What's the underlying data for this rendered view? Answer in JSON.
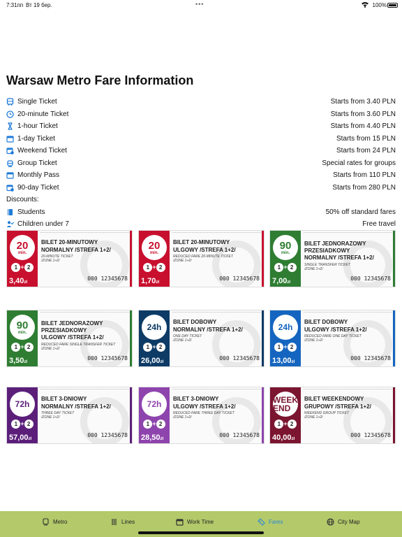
{
  "status": {
    "time": "7:31пп",
    "date": "Вт 19 бер.",
    "dots": "•••",
    "battery": "100%"
  },
  "page_title": "Warsaw Metro Fare Information",
  "fares": [
    {
      "name": "Single Ticket",
      "price": "Starts from 3.40 PLN",
      "icon": "bus-icon"
    },
    {
      "name": "20-minute Ticket",
      "price": "Starts from 3.60 PLN",
      "icon": "clock-icon"
    },
    {
      "name": "1-hour Ticket",
      "price": "Starts from 4.40 PLN",
      "icon": "hourglass-icon"
    },
    {
      "name": "1-day Ticket",
      "price": "Starts from 15 PLN",
      "icon": "calendar-icon"
    },
    {
      "name": "Weekend Ticket",
      "price": "Starts from 24 PLN",
      "icon": "calendar-clock-icon"
    },
    {
      "name": "Group Ticket",
      "price": "Special rates for groups",
      "icon": "tram-icon"
    },
    {
      "name": "Monthly Pass",
      "price": "Starts from 110 PLN",
      "icon": "calendar-icon"
    },
    {
      "name": "90-day Ticket",
      "price": "Starts from 280 PLN",
      "icon": "calendar-clock-icon"
    }
  ],
  "discounts_heading": "Discounts:",
  "discounts": [
    {
      "name": "Students",
      "value": "50% off standard fares",
      "icon": "book-icon"
    },
    {
      "name": "Children under 7",
      "value": "Free travel",
      "icon": "person-check-icon"
    }
  ],
  "tickets": [
    {
      "color": "#c8102e",
      "badge_num": "20",
      "badge_unit": "min.",
      "zones": [
        "1",
        "2"
      ],
      "price": "3,40",
      "currency": "zł",
      "title1": "BILET 20-MINUTOWY",
      "title2": "NORMALNY /STREFA 1+2/",
      "title3": "",
      "sub1": "20-MINUTE TICKET",
      "sub2": "/ZONE 1+2/",
      "serial": "000 12345678",
      "stripe": "#c8102e"
    },
    {
      "color": "#c8102e",
      "badge_num": "20",
      "badge_unit": "min.",
      "zones": [
        "1",
        "2"
      ],
      "price": "1,70",
      "currency": "zł",
      "title1": "BILET 20-MINUTOWY",
      "title2": "ULGOWY /STREFA 1+2/",
      "title3": "",
      "sub1": "REDUCED FARE 20-MINUTE TICKET",
      "sub2": "/ZONE 1+2/",
      "serial": "000 12345678",
      "stripe": "#c8102e"
    },
    {
      "color": "#2e7d32",
      "badge_num": "90",
      "badge_unit": "min.",
      "zones": [
        "1",
        "2"
      ],
      "price": "7,00",
      "currency": "zł",
      "title1": "BILET JEDNORAZOWY",
      "title2": "PRZESIADKOWY",
      "title3": "NORMALNY /STREFA 1+2/",
      "sub1": "SINGLE TRANSFER TICKET",
      "sub2": "/ZONE 1+2/",
      "serial": "000 12345678",
      "stripe": "#2e7d32"
    },
    {
      "color": "#2e7d32",
      "badge_num": "90",
      "badge_unit": "min.",
      "zones": [
        "1",
        "2"
      ],
      "price": "3,50",
      "currency": "zł",
      "title1": "BILET JEDNORAZOWY",
      "title2": "PRZESIADKOWY",
      "title3": "ULGOWY /STREFA 1+2/",
      "sub1": "REDUCED FARE SINGLE TRANSFER TICKET",
      "sub2": "/ZONE 1+2/",
      "serial": "000 12345678",
      "stripe": "#2e7d32"
    },
    {
      "color": "#0d3b66",
      "badge_num": "24h",
      "badge_unit": "",
      "zones": [
        "1",
        "2"
      ],
      "price": "26,00",
      "currency": "zł",
      "title1": "BILET DOBOWY",
      "title2": "NORMALNY /STREFA 1+2/",
      "title3": "",
      "sub1": "ONE DAY TICKET",
      "sub2": "/ZONE 1+2/",
      "serial": "000 12345678",
      "stripe": "#0d3b66"
    },
    {
      "color": "#1565c0",
      "badge_num": "24h",
      "badge_unit": "",
      "zones": [
        "1",
        "2"
      ],
      "price": "13,00",
      "currency": "zł",
      "title1": "BILET DOBOWY",
      "title2": "ULGOWY /STREFA 1+2/",
      "title3": "",
      "sub1": "REDUCED FARE ONE DAY TICKET",
      "sub2": "/ZONE 1+2/",
      "serial": "000 12345678",
      "stripe": "#1565c0"
    },
    {
      "color": "#5b1f7a",
      "badge_num": "72h",
      "badge_unit": "",
      "zones": [
        "1",
        "2"
      ],
      "price": "57,00",
      "currency": "zł",
      "title1": "BILET 3-DNIOWY",
      "title2": "NORMALNY /STREFA 1+2/",
      "title3": "",
      "sub1": "THREE DAY TICKET",
      "sub2": "/ZONE 1+2/",
      "serial": "000 12345678",
      "stripe": "#5b1f7a"
    },
    {
      "color": "#8e44ad",
      "badge_num": "72h",
      "badge_unit": "",
      "zones": [
        "1",
        "2"
      ],
      "price": "28,50",
      "currency": "zł",
      "title1": "BILET 3-DNIOWY",
      "title2": "ULGOWY /STREFA 1+2/",
      "title3": "",
      "sub1": "REDUCED FARE THREE DAY TICKET",
      "sub2": "/ZONE 1+2/",
      "serial": "000 12345678",
      "stripe": "#8e44ad"
    },
    {
      "color": "#7b1530",
      "badge_num": "WEEK END",
      "badge_unit": "",
      "zones": [
        "1",
        "2"
      ],
      "price": "40,00",
      "currency": "zł",
      "title1": "BILET WEEKENDOWY",
      "title2": "GRUPOWY /STREFA 1+2/",
      "title3": "",
      "sub1": "WEEKEND GROUP TICKET",
      "sub2": "/ZONE 1+2/",
      "serial": "000 12345678",
      "stripe": "#7b1530"
    }
  ],
  "tabs": [
    {
      "label": "Metro",
      "icon": "train-icon",
      "active": false
    },
    {
      "label": "Lines",
      "icon": "lines-icon",
      "active": false
    },
    {
      "label": "Work Time",
      "icon": "calendar-icon",
      "active": false
    },
    {
      "label": "Fares",
      "icon": "ticket-icon",
      "active": true
    },
    {
      "label": "City Map",
      "icon": "globe-icon",
      "active": false
    }
  ],
  "colors": {
    "tabbar": "#b3c96a",
    "accent": "#2a86d8",
    "list_icon": "#1e7bd8"
  }
}
